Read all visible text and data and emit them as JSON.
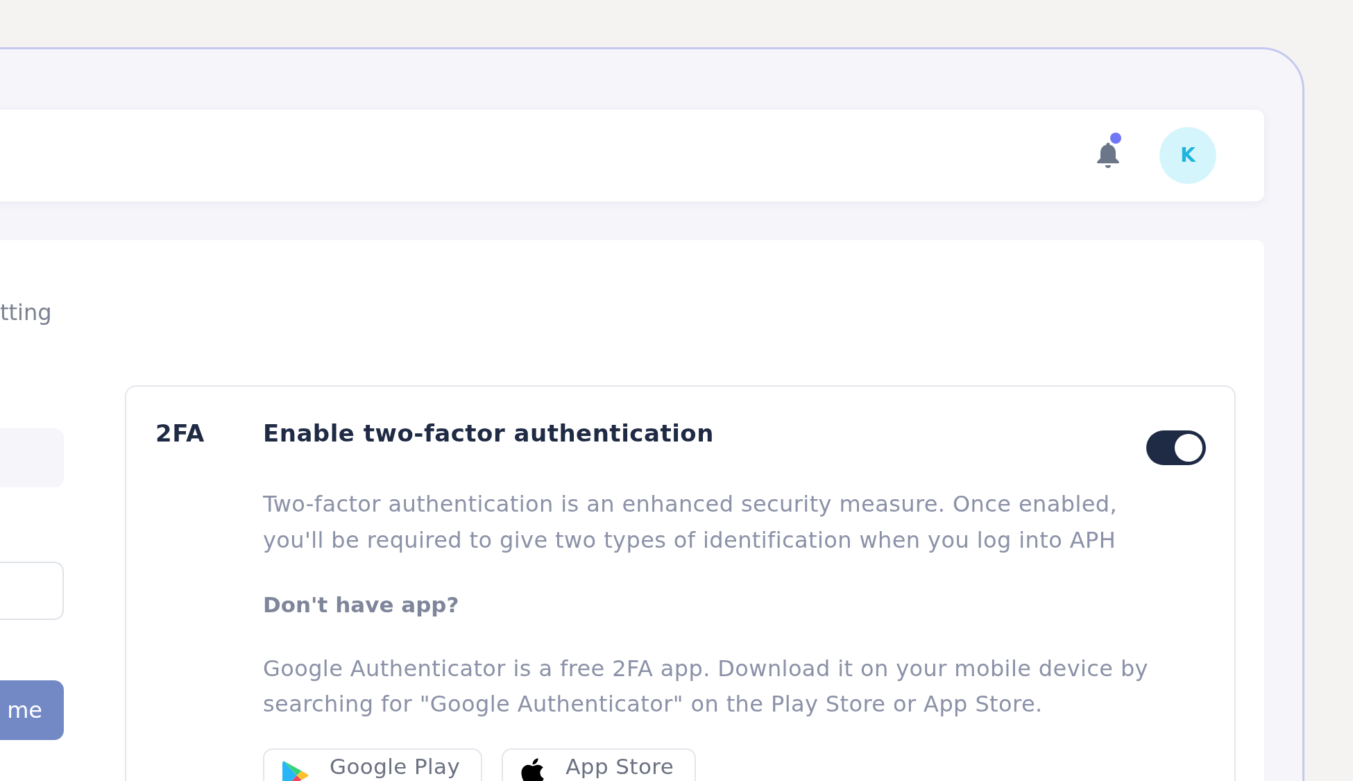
{
  "header": {
    "notifications": {
      "unread": true
    },
    "avatar": {
      "initial": "K"
    }
  },
  "page": {
    "heading": "tting",
    "form": {
      "fields": [
        {
          "disabled": true
        },
        {
          "disabled": false
        }
      ],
      "button": "me"
    }
  },
  "two_factor_card": {
    "tag": "2FA",
    "title": "Enable two-factor authentication",
    "enabled": true,
    "description": "Two-factor authentication is an enhanced security measure. Once enabled, you'll be required to give two types of identification when you log into APH",
    "subheading": "Don't have app?",
    "help_text": "Google Authenticator is a free 2FA app. Download it on your mobile device by searching for \"Google Authenticator\" on the Play Store or App Store.",
    "store_buttons": [
      {
        "kind": "google-play",
        "label": "Google Play"
      },
      {
        "kind": "app-store",
        "label": "App Store"
      }
    ]
  }
}
